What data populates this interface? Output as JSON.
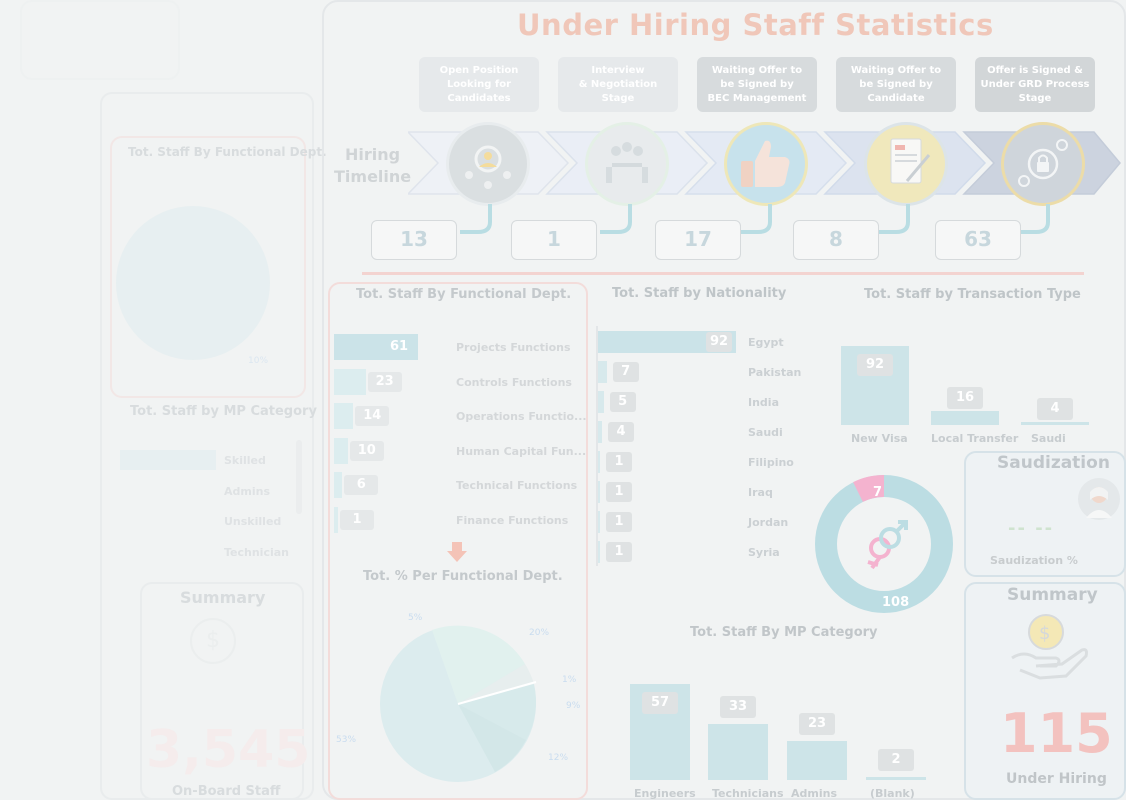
{
  "title": "Under Hiring Staff Statistics",
  "timeline_label": [
    "Hiring",
    "Timeline"
  ],
  "stages": [
    {
      "label": [
        "Open Position",
        "Looking for",
        "Candidates"
      ],
      "count": "13"
    },
    {
      "label": [
        "Interview",
        "& Negotiation",
        "Stage"
      ],
      "count": "1"
    },
    {
      "label": [
        "Waiting Offer to",
        "be Signed by",
        "BEC Management"
      ],
      "count": "17"
    },
    {
      "label": [
        "Waiting Offer to",
        "be Signed by",
        "Candidate"
      ],
      "count": "8"
    },
    {
      "label": [
        "Offer is Signed &",
        "Under GRD Process",
        "Stage"
      ],
      "count": "63"
    }
  ],
  "functional": {
    "title": "Tot. Staff By Functional Dept.",
    "pct_title": "Tot. % Per Functional Dept.",
    "items": [
      {
        "label": "Projects Functions",
        "value": "61"
      },
      {
        "label": "Controls Functions",
        "value": "23"
      },
      {
        "label": "Operations Functio...",
        "value": "14"
      },
      {
        "label": "Human Capital Fun...",
        "value": "10"
      },
      {
        "label": "Technical Functions",
        "value": "6"
      },
      {
        "label": "Finance Functions",
        "value": "1"
      }
    ],
    "pie_labels": [
      "5%",
      "20%",
      "1%",
      "9%",
      "12%",
      "53%"
    ]
  },
  "nationality": {
    "title": "Tot. Staff by Nationality",
    "items": [
      {
        "label": "Egypt",
        "value": "92"
      },
      {
        "label": "Pakistan",
        "value": "7"
      },
      {
        "label": "India",
        "value": "5"
      },
      {
        "label": "Saudi",
        "value": "4"
      },
      {
        "label": "Filipino",
        "value": "1"
      },
      {
        "label": "Iraq",
        "value": "1"
      },
      {
        "label": "Jordan",
        "value": "1"
      },
      {
        "label": "Syria",
        "value": "1"
      }
    ]
  },
  "transaction": {
    "title": "Tot. Staff by Transaction Type",
    "items": [
      {
        "label": "New Visa",
        "value": "92"
      },
      {
        "label": "Local Transfer",
        "value": "16"
      },
      {
        "label": "Saudi",
        "value": "4"
      }
    ]
  },
  "gender": {
    "female": "7",
    "male": "108"
  },
  "mp_category": {
    "title": "Tot. Staff By MP Category",
    "items": [
      {
        "label": "Engineers",
        "value": "57"
      },
      {
        "label": "Technicians",
        "value": "33"
      },
      {
        "label": "Admins",
        "value": "23"
      },
      {
        "label": "(Blank)",
        "value": "2"
      }
    ]
  },
  "saudization": {
    "title": "Saudization",
    "value": "-- --",
    "label": "Saudization %"
  },
  "summary": {
    "title": "Summary",
    "value": "115",
    "label": "Under Hiring"
  },
  "ghost_left": {
    "panel_title": "Tot. Staff By Functional Dept.",
    "pie_pct": "10%",
    "mp_title": "Tot. Staff by MP Category",
    "mp_items": [
      "Skilled",
      "Admins",
      "Unskilled",
      "Technician"
    ],
    "summary_title": "Summary",
    "onboard_value": "3,545",
    "onboard_label": "On-Board Staff"
  },
  "colors": {
    "accent": "#d3e6ea",
    "title": "#f0c7b9",
    "female": "#f4b3cf",
    "male": "#bcdde3",
    "highlight": "#f0b7b0"
  }
}
